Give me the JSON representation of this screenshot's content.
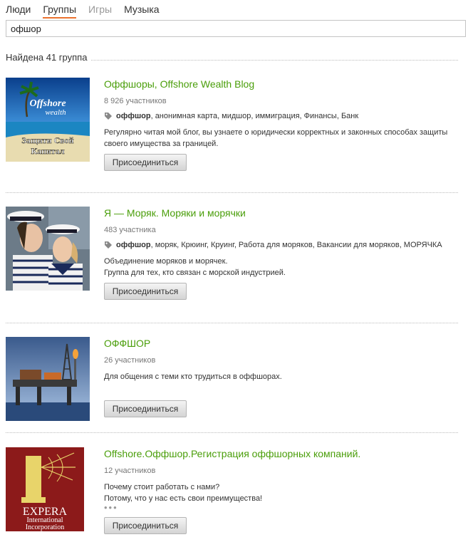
{
  "tabs": [
    {
      "label": "Люди",
      "state": "normal"
    },
    {
      "label": "Группы",
      "state": "active"
    },
    {
      "label": "Игры",
      "state": "disabled"
    },
    {
      "label": "Музыка",
      "state": "normal"
    }
  ],
  "search": {
    "value": "офшор"
  },
  "results": {
    "found_text": "Найдена 41 группа"
  },
  "accent_color": "#eb722e",
  "link_color": "#4a9e0a",
  "groups": [
    {
      "title": "Оффшоры, Offshore Wealth Blog",
      "members": "8 926 участников",
      "tag_icon": "tag-icon",
      "tags_bold": "оффшор",
      "tags_rest": ", анонимная карта, мидшор, иммиграция, Финансы, Банк",
      "description": [
        "Регулярно читая мой блог, вы узнаете о юридически корректных и законных способах защиты",
        "своего имущества за границей."
      ],
      "thumb_text": {
        "line1": "Offshore",
        "line2": "wealth",
        "line3": "Защити Свой",
        "line4": "Капитал"
      },
      "join_label": "Присоединиться"
    },
    {
      "title": "Я — Моряк. Моряки и морячки",
      "members": "483 участника",
      "tag_icon": "tag-icon",
      "tags_bold": "оффшор",
      "tags_rest": ", моряк, Крюинг, Круинг, Работа для моряков, Вакансии для моряков, МОРЯЧКА",
      "description": [
        "Объединение моряков и морячек.",
        "Группа для тех, кто связан с морской индустрией."
      ],
      "join_label": "Присоединиться"
    },
    {
      "title": "ОФФШОР",
      "members": "26 участников",
      "description": [
        "Для общения с теми кто трудиться в оффшорах."
      ],
      "join_label": "Присоединиться"
    },
    {
      "title": "Offshore.Оффшор.Регистрация оффшорных компаний.",
      "members": "12 участников",
      "description": [
        "Почему стоит работать с нами?",
        "Потому, что у нас есть свои преимущества!"
      ],
      "ellipsis": "•••",
      "thumb_text": {
        "line1": "EXPERA",
        "line2": "International",
        "line3": "Incorporation"
      },
      "join_label": "Присоединиться"
    }
  ]
}
